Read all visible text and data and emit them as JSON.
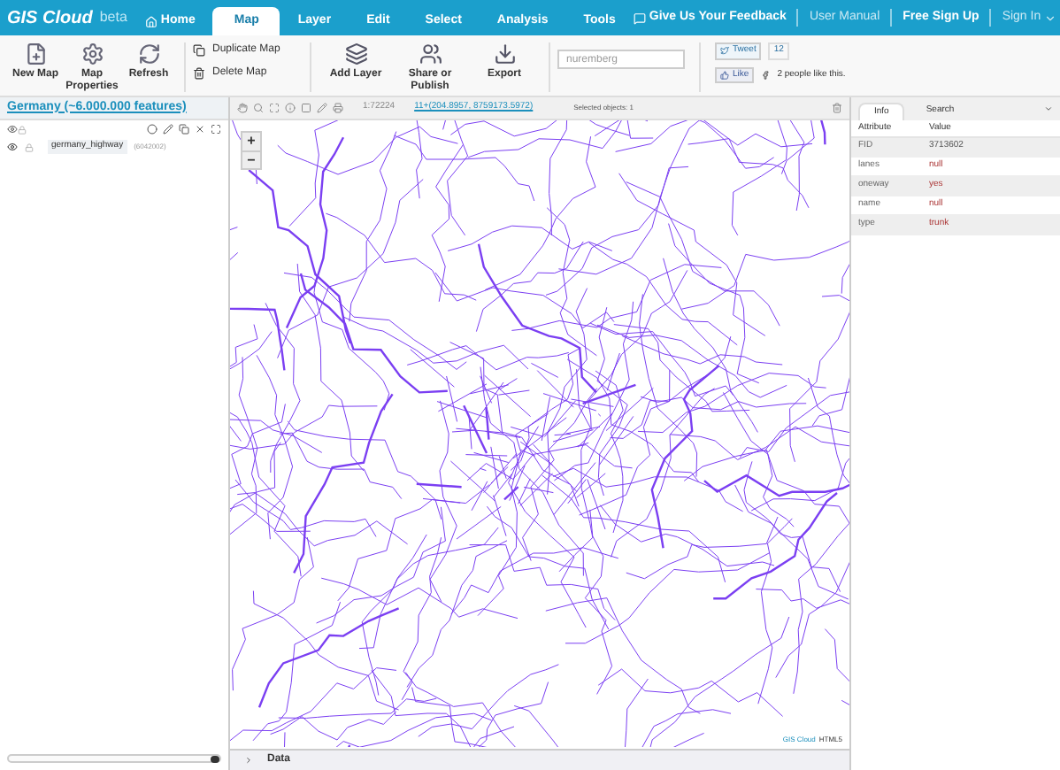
{
  "logo": {
    "name": "GIS Cloud",
    "badge": "beta"
  },
  "menu_tabs": [
    {
      "label": "Home",
      "selected": false
    },
    {
      "label": "Map",
      "selected": true
    },
    {
      "label": "Layer",
      "selected": false
    },
    {
      "label": "Edit",
      "selected": false
    },
    {
      "label": "Select",
      "selected": false
    },
    {
      "label": "Analysis",
      "selected": false
    },
    {
      "label": "Tools",
      "selected": false
    }
  ],
  "top_links": [
    {
      "label": "Give Us Your Feedback",
      "kind": "feedback"
    },
    {
      "label": "User Manual",
      "kind": "plain"
    },
    {
      "label": "Free Sign Up",
      "kind": "bold"
    },
    {
      "label": "Sign In",
      "kind": "dropdown"
    }
  ],
  "ribbon": {
    "big_buttons_left": [
      {
        "label": "New Map",
        "kind": "new"
      },
      {
        "label": "Map Properties",
        "kind": "props"
      },
      {
        "label": "Refresh",
        "kind": "refresh"
      }
    ],
    "small_buttons": [
      "Duplicate Map",
      "Delete Map"
    ],
    "big_buttons_right": [
      {
        "label": "Add Layer",
        "kind": "layers"
      },
      {
        "label": "Share or Publish",
        "kind": "share"
      },
      {
        "label": "Export",
        "kind": "export"
      }
    ],
    "search": {
      "placeholder": "nuremberg"
    },
    "tweet": {
      "label": "Tweet",
      "count": "12"
    },
    "like": {
      "label": "Like",
      "text": "2 people like this."
    }
  },
  "layers_panel": {
    "title": "Germany (~6.000.000 features)",
    "layers": [
      {
        "name": "germany_highway",
        "count": "(6042002)"
      }
    ]
  },
  "map_toolbar": {
    "scale": "1:72224",
    "coordinates": "11+(204.8957, 8759173.5972)",
    "selected": "Selected objects: 1"
  },
  "zoom_controls": [
    "+",
    "−"
  ],
  "attribution": {
    "link": "GIS Cloud",
    "text": "HTML5"
  },
  "info_panel": {
    "tabs": [
      {
        "label": "Info",
        "selected": true
      },
      {
        "label": "Search",
        "selected": false
      }
    ],
    "columns": [
      "Attribute",
      "Value"
    ],
    "rows": [
      {
        "attribute": "FID",
        "value": "3713602",
        "kind": "number"
      },
      {
        "attribute": "lanes",
        "value": "null",
        "kind": "text"
      },
      {
        "attribute": "oneway",
        "value": "yes",
        "kind": "text"
      },
      {
        "attribute": "name",
        "value": "null",
        "kind": "text"
      },
      {
        "attribute": "type",
        "value": "trunk",
        "kind": "text"
      }
    ]
  },
  "bottom_bar": {
    "label": "Data"
  }
}
